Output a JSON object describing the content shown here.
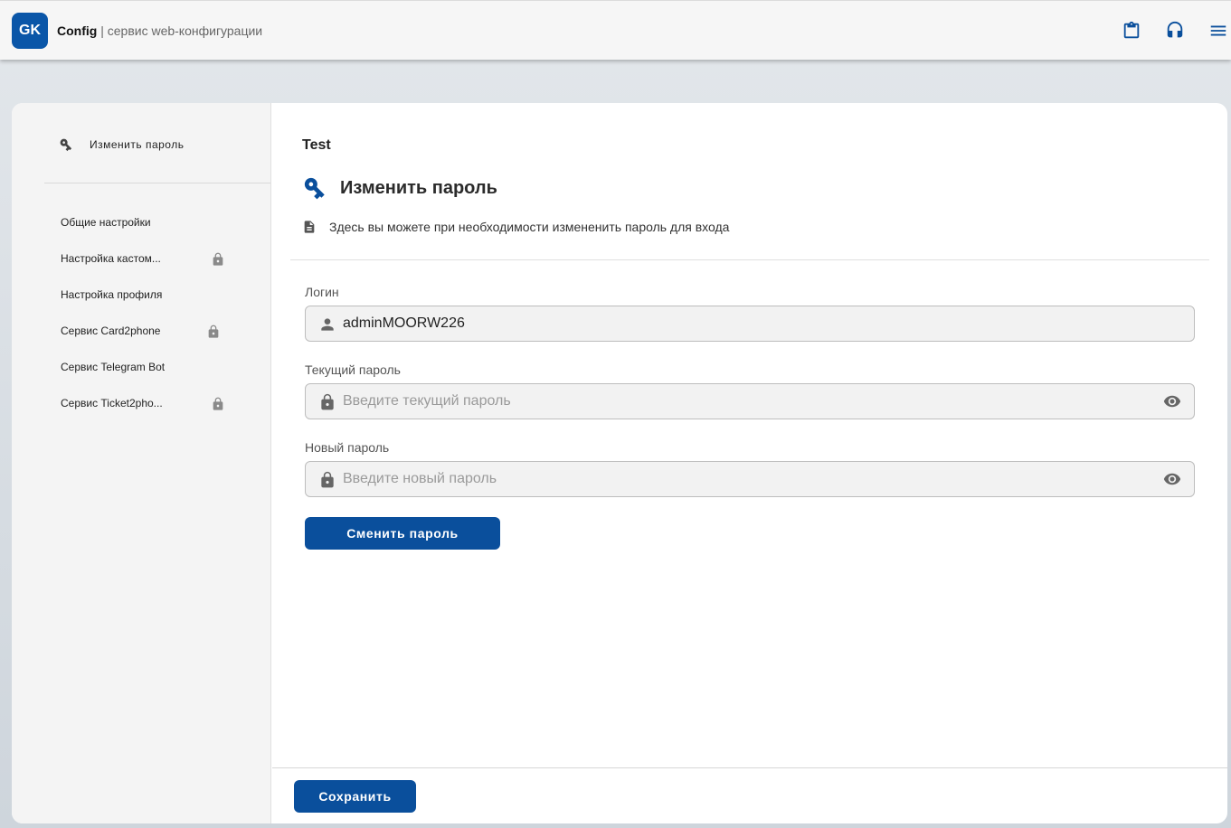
{
  "header": {
    "logo_text": "GK",
    "app_name": "Config",
    "app_subtitle": "| сервис web-конфигурации",
    "icons": [
      "clipboard-icon",
      "headset-icon",
      "menu-icon"
    ],
    "accent_color": "#0a56a8"
  },
  "sidebar": {
    "header_label": "Изменить пароль",
    "items": [
      {
        "label": "Общие настройки",
        "locked": false
      },
      {
        "label": "Настройка кастом...",
        "locked": true
      },
      {
        "label": "Настройка профиля",
        "locked": false
      },
      {
        "label": "Сервис Card2phone",
        "locked": true
      },
      {
        "label": "Сервис Telegram Bot",
        "locked": false
      },
      {
        "label": "Сервис Ticket2pho...",
        "locked": true
      }
    ]
  },
  "main": {
    "section_title": "Test",
    "page_title": "Изменить пароль",
    "description": "Здесь вы можете при необходимости измененить пароль для входа",
    "login": {
      "label": "Логин",
      "value": "adminMOORW226"
    },
    "current_password": {
      "label": "Текущий пароль",
      "placeholder": "Введите текущий пароль",
      "value": ""
    },
    "new_password": {
      "label": "Новый пароль",
      "placeholder": "Введите новый пароль",
      "value": ""
    },
    "change_button_label": "Сменить пароль",
    "save_button_label": "Сохранить"
  }
}
